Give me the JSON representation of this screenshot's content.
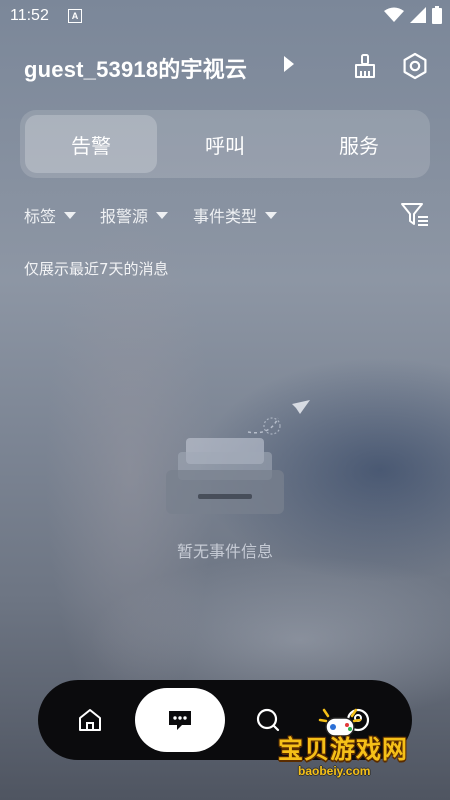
{
  "status_bar": {
    "time": "11:52",
    "notification_letter": "A"
  },
  "header": {
    "account_title": "guest_53918的宇视云"
  },
  "tabs": [
    {
      "label": "告警",
      "active": true
    },
    {
      "label": "呼叫",
      "active": false
    },
    {
      "label": "服务",
      "active": false
    }
  ],
  "filters": {
    "tag": "标签",
    "source": "报警源",
    "event_type": "事件类型"
  },
  "notice": "仅展示最近7天的消息",
  "empty_state": {
    "text": "暂无事件信息"
  },
  "bottom_nav": [
    "home-icon",
    "message-icon",
    "search-icon",
    "profile-icon"
  ],
  "watermark": {
    "text": "宝贝游戏网",
    "url": "baobeiy.com"
  },
  "colors": {
    "watermark": "#f5c018",
    "nav_bg": "#0b0b0d"
  }
}
